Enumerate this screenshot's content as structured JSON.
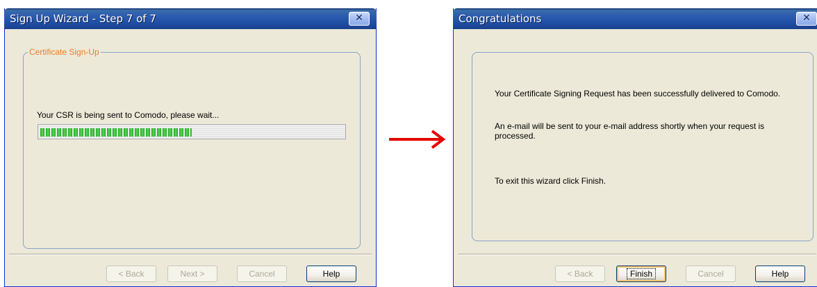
{
  "left_window": {
    "title": "Sign Up Wizard - Step 7 of 7",
    "close_label": "✕",
    "group_title": "Certificate Sign-Up",
    "status_text": "Your CSR is being sent to Comodo, please wait...",
    "progress": 0.5,
    "buttons": {
      "back": "< Back",
      "next": "Next >",
      "cancel": "Cancel",
      "help": "Help"
    }
  },
  "right_window": {
    "title": "Congratulations",
    "close_label": "✕",
    "message_1": "Your Certificate Signing Request has been successfully delivered to Comodo.",
    "message_2": "An e-mail will be sent to your e-mail address shortly when your request is processed.",
    "message_3": "To exit this wizard click Finish.",
    "buttons": {
      "back": "< Back",
      "finish": "Finish",
      "cancel": "Cancel",
      "help": "Help"
    }
  },
  "colors": {
    "arrow": "#e60000",
    "legend": "#ef7d25",
    "progress_green": "#1ea81e"
  },
  "icons": {
    "arrow": "right-arrow-icon",
    "close": "close-icon"
  }
}
